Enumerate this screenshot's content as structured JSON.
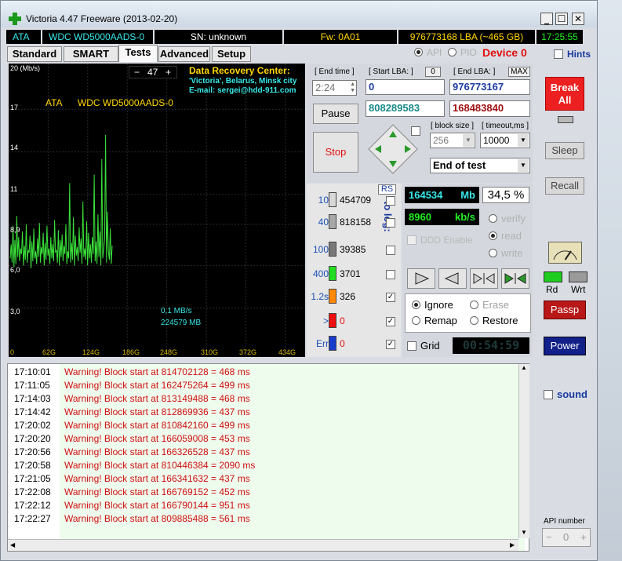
{
  "window": {
    "title": "Victoria 4.47  Freeware (2013-02-20)"
  },
  "status": {
    "interface": "ATA",
    "model": "WDC WD5000AADS-0",
    "serial": "SN: unknown",
    "firmware": "Fw: 0A01",
    "capacity": "976773168 LBA (~465 GB)",
    "clock": "17:25:55"
  },
  "tabs": [
    "Standard",
    "SMART",
    "Tests",
    "Advanced",
    "Setup"
  ],
  "mode": {
    "api": "API",
    "pio": "PIO",
    "device": "Device 0",
    "hints": "Hints"
  },
  "graph": {
    "ylabel": "20 (Mb/s)",
    "speed_value": "47",
    "y_ticks": [
      "17",
      "14",
      "11",
      "8,9",
      "6,0",
      "3,0"
    ],
    "x_ticks": [
      "0",
      "62G",
      "124G",
      "186G",
      "248G",
      "310G",
      "372G",
      "434G"
    ],
    "drive_line": "ATA      WDC WD5000AADS-0",
    "current_speed": "0,1 MB/s",
    "current_pos": "224579 MB",
    "drc_title": "Data Recovery Center:",
    "drc_city": "'Victoria', Belarus, Minsk city",
    "drc_email": "E-mail: sergei@hdd-911.com",
    "samples": [
      6.5,
      7.5,
      6.2,
      8.8,
      5.9,
      7.8,
      6.1,
      9.5,
      6.6,
      8.0,
      6.3,
      7.2,
      6.8,
      8.4,
      6.0,
      7.4,
      6.4,
      8.9,
      6.2,
      7.1,
      6.9,
      8.1,
      5.8,
      7.7,
      6.3,
      8.6,
      6.5,
      7.0,
      6.1,
      7.9,
      6.6,
      9.0,
      6.2,
      7.3,
      6.8,
      8.3,
      6.0,
      7.6,
      6.4,
      8.8,
      6.7,
      7.2,
      6.1,
      8.0,
      6.5,
      7.5,
      6.3,
      9.2,
      6.9,
      7.1,
      6.2,
      8.5,
      6.0,
      7.8,
      6.6,
      8.2,
      6.3,
      7.4,
      6.8,
      8.9,
      6.1,
      7.0,
      6.5,
      11.8,
      6.2,
      7.6,
      6.4,
      9.4,
      6.0,
      8.1,
      6.7,
      7.3,
      6.3,
      8.7,
      6.9,
      7.9,
      6.1,
      10.5,
      6.6,
      7.2,
      6.4,
      9.1,
      6.0,
      8.3,
      6.5,
      7.5,
      6.2,
      8.0,
      6.8,
      12.4,
      6.3,
      7.7,
      6.1,
      9.6,
      6.6,
      8.4,
      6.0,
      13.5,
      6.5,
      7.1,
      7.9,
      15.2,
      6.2,
      9.8,
      7.0,
      6.4,
      8.6,
      6.1,
      7.4
    ]
  },
  "controls": {
    "end_time_label": "[ End time ]",
    "end_time_value": "2:24",
    "start_lba_label": "[ Start LBA: ]",
    "start_lba_zero": "0",
    "start_lba_value": "0",
    "end_lba_label": "[ End LBA: ]",
    "end_lba_max": "MAX",
    "end_lba_value": "976773167",
    "current_lba": "808289583",
    "remaining_lba": "168483840",
    "pause": "Pause",
    "stop": "Stop",
    "block_size_label": "[ block size ]",
    "block_size_value": "256",
    "timeout_label": "[ timeout,ms ]",
    "timeout_value": "10000",
    "end_action": "End of test"
  },
  "blocks": {
    "rs": "RS",
    "to_log": "to log:",
    "rows": [
      {
        "label": "10",
        "count": "454709",
        "color": "#d8d8d8",
        "checked": false
      },
      {
        "label": "40",
        "count": "818158",
        "color": "#a8a8a8",
        "checked": false
      },
      {
        "label": "100",
        "count": "39385",
        "color": "#787878",
        "checked": false
      },
      {
        "label": "400",
        "count": "3701",
        "color": "#22dd22",
        "checked": false
      },
      {
        "label": "1.2s",
        "count": "326",
        "color": "#ff8800",
        "checked": true
      },
      {
        "label": ">",
        "count": "0",
        "color": "#ee1010",
        "checked": true
      },
      {
        "label": "Err",
        "count": "0",
        "color": "#1a3ccc",
        "checked": true
      }
    ]
  },
  "stats": {
    "mb_done": "164534",
    "mb_unit": "Mb",
    "percent": "34,5 %",
    "speed": "8960",
    "speed_unit": "kb/s",
    "ddd": "DDD Enable",
    "verify": "verify",
    "read": "read",
    "write": "write",
    "ignore": "Ignore",
    "erase": "Erase",
    "remap": "Remap",
    "restore": "Restore",
    "grid": "Grid",
    "timer": "00:54:59"
  },
  "side": {
    "break_all": "Break All",
    "sleep": "Sleep",
    "recall": "Recall",
    "rd": "Rd",
    "wrt": "Wrt",
    "passp": "Passp",
    "power": "Power",
    "sound": "sound",
    "api_number_label": "API number",
    "api_number": "0"
  },
  "log": [
    {
      "time": "17:10:01",
      "msg": "Warning! Block start at 814702128 = 468 ms"
    },
    {
      "time": "17:11:05",
      "msg": "Warning! Block start at 162475264 = 499 ms"
    },
    {
      "time": "17:14:03",
      "msg": "Warning! Block start at 813149488 = 468 ms"
    },
    {
      "time": "17:14:42",
      "msg": "Warning! Block start at 812869936 = 437 ms"
    },
    {
      "time": "17:20:02",
      "msg": "Warning! Block start at 810842160 = 499 ms"
    },
    {
      "time": "17:20:20",
      "msg": "Warning! Block start at 166059008 = 453 ms"
    },
    {
      "time": "17:20:56",
      "msg": "Warning! Block start at 166326528 = 437 ms"
    },
    {
      "time": "17:20:58",
      "msg": "Warning! Block start at 810446384 = 2090 ms"
    },
    {
      "time": "17:21:05",
      "msg": "Warning! Block start at 166341632 = 437 ms"
    },
    {
      "time": "17:22:08",
      "msg": "Warning! Block start at 166769152 = 452 ms"
    },
    {
      "time": "17:22:12",
      "msg": "Warning! Block start at 166790144 = 951 ms"
    },
    {
      "time": "17:22:27",
      "msg": "Warning! Block start at 809885488 = 561 ms"
    }
  ]
}
